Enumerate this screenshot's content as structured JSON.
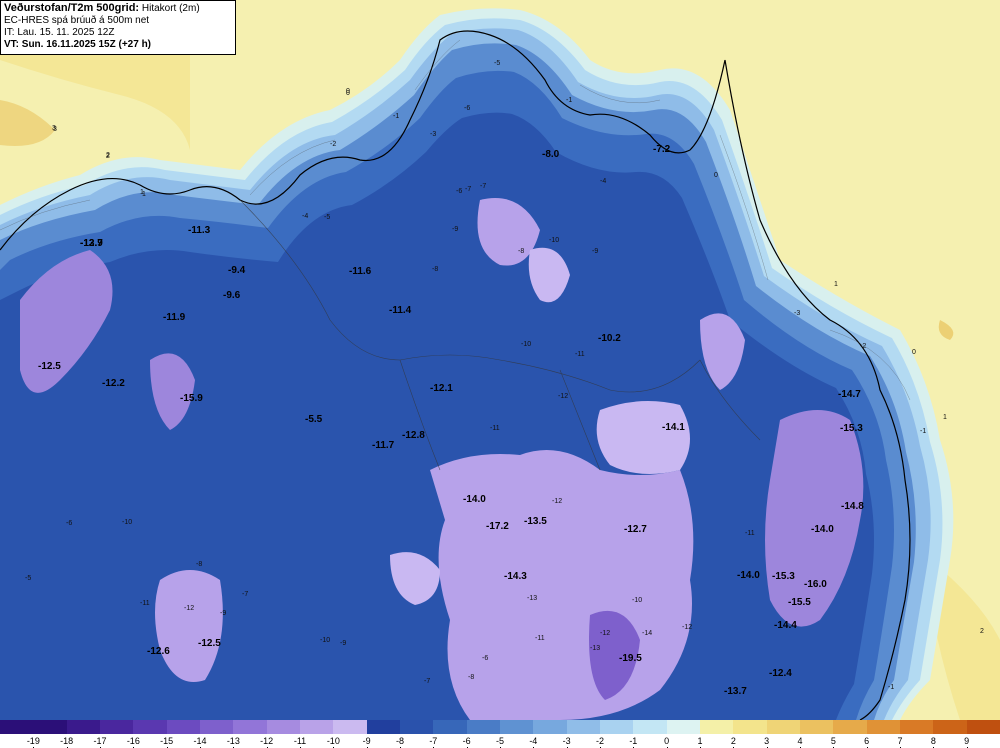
{
  "header": {
    "line1_bold": "Veðurstofan/T2m 500grid:",
    "line1_rest": " Hitakort (2m)",
    "line2": "EC-HRES spá brúuð á 500m net",
    "line3": "IT: Lau. 15. 11. 2025 12Z",
    "line4": "VT: Sun. 16.11.2025 15Z (+27 h)"
  },
  "colorbar": {
    "colors": [
      "#2b0f78",
      "#3a1a8c",
      "#4a279e",
      "#5a38b0",
      "#6c4bc0",
      "#7e60cc",
      "#9275d8",
      "#a68be0",
      "#b9a2e8",
      "#cbbaf0",
      "#213f9e",
      "#2a52ac",
      "#3767b9",
      "#4a7cc6",
      "#5f92d2",
      "#77a8de",
      "#90bde8",
      "#a9d2f0",
      "#c3e6f4",
      "#ddf3f2",
      "#f4f0a8",
      "#f3e48c",
      "#efd476",
      "#ebc160",
      "#e6aa4a",
      "#e09236",
      "#d97a26",
      "#cc6418",
      "#bf5010"
    ],
    "labels": [
      "-19",
      "-18",
      "-17",
      "-16",
      "-15",
      "-14",
      "-13",
      "-12",
      "-11",
      "-10",
      "-9",
      "-8",
      "-7",
      "-6",
      "-5",
      "-4",
      "-3",
      "-2",
      "-1",
      "0",
      "1",
      "2",
      "3",
      "4",
      "5",
      "6",
      "7",
      "8",
      "9"
    ]
  },
  "temperature_labels": [
    {
      "text": "-12.7",
      "bold": true
    },
    {
      "text": "-11.3",
      "bold": true
    },
    {
      "text": "-9.4",
      "bold": true
    },
    {
      "text": "-9.6",
      "bold": true
    },
    {
      "text": "-11.9",
      "bold": true
    },
    {
      "text": "-12.5",
      "bold": true
    },
    {
      "text": "-12.2",
      "bold": true
    },
    {
      "text": "-15.9",
      "bold": true
    },
    {
      "text": "-5.5",
      "bold": true
    },
    {
      "text": "-11.6",
      "bold": true
    },
    {
      "text": "-11.4",
      "bold": true
    },
    {
      "text": "-12.1",
      "bold": true
    },
    {
      "text": "-12.8",
      "bold": true
    },
    {
      "text": "-11.7",
      "bold": true
    },
    {
      "text": "-8.0",
      "bold": true
    },
    {
      "text": "-7.2",
      "bold": true
    },
    {
      "text": "-10.2",
      "bold": true
    },
    {
      "text": "-14.1",
      "bold": true
    },
    {
      "text": "-14.0",
      "bold": true
    },
    {
      "text": "-17.2",
      "bold": true
    },
    {
      "text": "-13.5",
      "bold": true
    },
    {
      "text": "-12.7",
      "bold": true
    },
    {
      "text": "-14.3",
      "bold": true
    },
    {
      "text": "-14.0",
      "bold": true
    },
    {
      "text": "-12.6",
      "bold": true
    },
    {
      "text": "-12.5",
      "bold": true
    },
    {
      "text": "-19.5",
      "bold": true
    },
    {
      "text": "-13.7",
      "bold": true
    },
    {
      "text": "-12.4",
      "bold": true
    },
    {
      "text": "-14.4",
      "bold": true
    },
    {
      "text": "-15.5",
      "bold": true
    },
    {
      "text": "-15.3",
      "bold": true
    },
    {
      "text": "-16.0",
      "bold": true
    },
    {
      "text": "-14.0",
      "bold": true
    },
    {
      "text": "-14.8",
      "bold": true
    },
    {
      "text": "-15.3",
      "bold": true
    },
    {
      "text": "-14.7",
      "bold": true
    },
    {
      "text": "-13.9",
      "bold": true
    }
  ],
  "contour_labels": [
    "3",
    "2",
    "1",
    "0",
    "-1",
    "-2",
    "-3",
    "-4",
    "-5",
    "-6",
    "-7",
    "-8",
    "-9",
    "-10",
    "-11",
    "-12",
    "0",
    "1",
    "2",
    "-1",
    "1",
    "0",
    "-1",
    "-2",
    "-3",
    "3",
    "2",
    "1",
    "0",
    "-1",
    "-5",
    "-6",
    "-7",
    "-8",
    "-10",
    "-11",
    "-12",
    "-13",
    "-9",
    "-4",
    "-5",
    "-6",
    "-8",
    "-10",
    "-12",
    "-11",
    "-7",
    "-9",
    "-12",
    "-13",
    "-14",
    "-10",
    "-9",
    "-7",
    "-8",
    "-6",
    "-11",
    "-10",
    "-12",
    "-11"
  ]
}
